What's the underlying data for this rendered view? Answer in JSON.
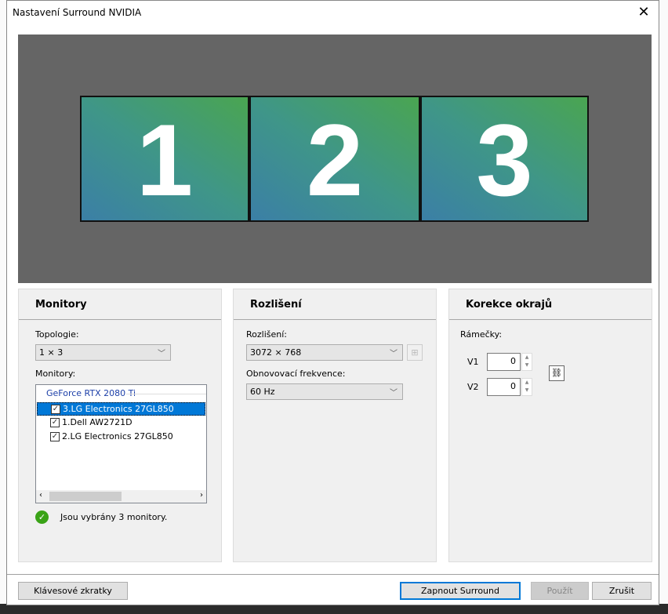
{
  "window": {
    "title": "Nastavení Surround NVIDIA",
    "close": "✕"
  },
  "preview": {
    "monitors": [
      "1",
      "2",
      "3"
    ]
  },
  "monitors_panel": {
    "heading": "Monitory",
    "topology_label": "Topologie:",
    "topology_value": "1 × 3",
    "monitors_label": "Monitory:",
    "gpu": "GeForce RTX 2080 Ti",
    "items": [
      {
        "label": "3.LG Electronics 27GL850",
        "checked": true
      },
      {
        "label": "1.Dell AW2721D",
        "checked": true
      },
      {
        "label": "2.LG Electronics 27GL850",
        "checked": true
      }
    ],
    "status": "Jsou vybrány 3 monitory."
  },
  "resolution_panel": {
    "heading": "Rozlišení",
    "resolution_label": "Rozlišení:",
    "resolution_value": "3072 × 768",
    "refresh_label": "Obnovovací frekvence:",
    "refresh_value": "60  Hz"
  },
  "bezel_panel": {
    "heading": "Korekce okrajů",
    "bezels_label": "Rámečky:",
    "v1_label": "V1",
    "v1_value": "0",
    "v2_label": "V2",
    "v2_value": "0"
  },
  "buttons": {
    "shortcuts": "Klávesové zkratky",
    "enable": "Zapnout Surround",
    "apply": "Použít",
    "cancel": "Zrušit"
  }
}
